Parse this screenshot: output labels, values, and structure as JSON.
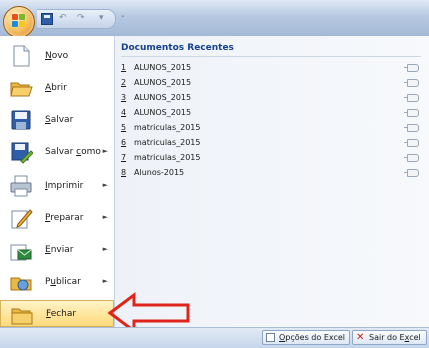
{
  "quick_access": {
    "separator": "-"
  },
  "commands": [
    {
      "label_pre": "",
      "label_ul": "N",
      "label_post": "ovo",
      "has_submenu": false,
      "icon": "new-document-icon"
    },
    {
      "label_pre": "",
      "label_ul": "A",
      "label_post": "brir",
      "has_submenu": false,
      "icon": "open-folder-icon"
    },
    {
      "label_pre": "",
      "label_ul": "S",
      "label_post": "alvar",
      "has_submenu": false,
      "icon": "save-disk-icon"
    },
    {
      "label_pre": "Salvar ",
      "label_ul": "c",
      "label_post": "omo",
      "has_submenu": true,
      "icon": "save-as-icon"
    },
    {
      "label_pre": "",
      "label_ul": "I",
      "label_post": "mprimir",
      "has_submenu": true,
      "icon": "printer-icon"
    },
    {
      "label_pre": "",
      "label_ul": "P",
      "label_post": "reparar",
      "has_submenu": true,
      "icon": "prepare-pencil-icon"
    },
    {
      "label_pre": "",
      "label_ul": "E",
      "label_post": "nviar",
      "has_submenu": true,
      "icon": "send-icon"
    },
    {
      "label_pre": "P",
      "label_ul": "u",
      "label_post": "blicar",
      "has_submenu": true,
      "icon": "publish-icon"
    },
    {
      "label_pre": "",
      "label_ul": "F",
      "label_post": "echar",
      "has_submenu": false,
      "icon": "close-folder-icon",
      "highlighted": true
    }
  ],
  "recent": {
    "title": "Documentos Recentes",
    "items": [
      {
        "num": "1",
        "name": "ALUNOS_2015"
      },
      {
        "num": "2",
        "name": "ALUNOS_2015"
      },
      {
        "num": "3",
        "name": "ALUNOS_2015"
      },
      {
        "num": "4",
        "name": "ALUNOS_2015"
      },
      {
        "num": "5",
        "name": "matriculas_2015"
      },
      {
        "num": "6",
        "name": "matriculas_2015"
      },
      {
        "num": "7",
        "name": "matriculas_2015"
      },
      {
        "num": "8",
        "name": "Alunos-2015"
      }
    ]
  },
  "footer": {
    "options_pre": "",
    "options_ul": "O",
    "options_post": "pções do Excel",
    "exit_pre": "Sair do E",
    "exit_ul": "x",
    "exit_post": "cel"
  },
  "colors": {
    "highlight": "#ffd97a",
    "arrow": "#e0241b",
    "recent_title": "#15428b"
  }
}
